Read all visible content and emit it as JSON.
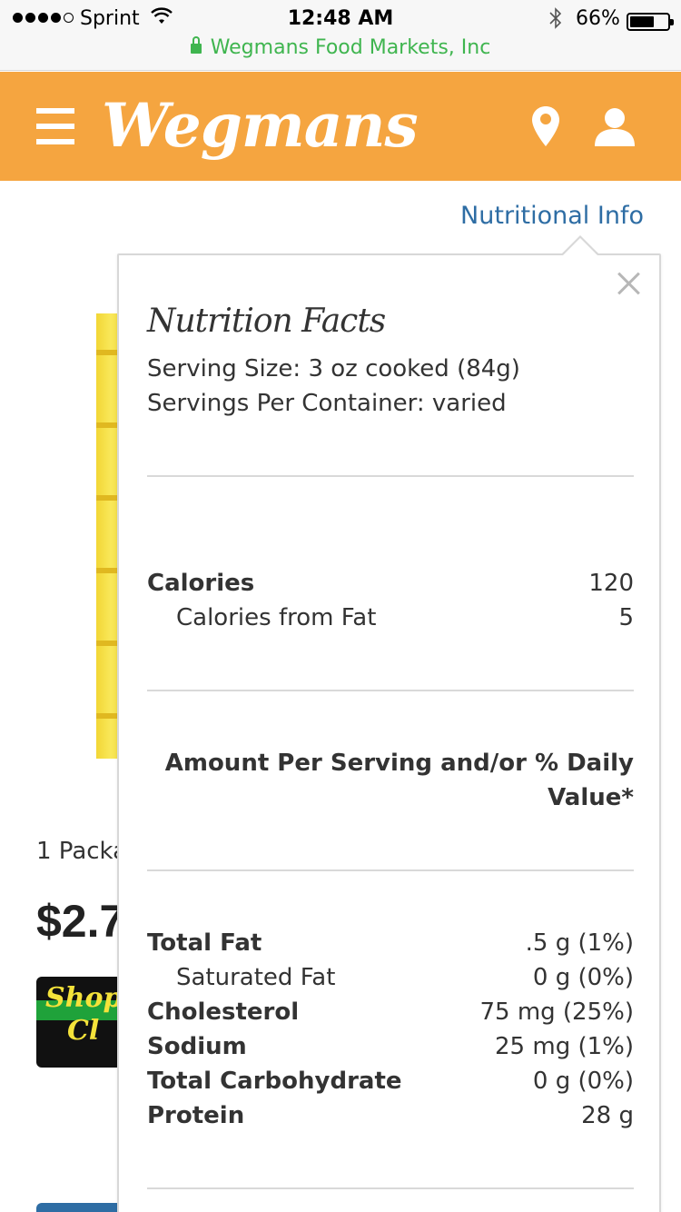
{
  "status_bar": {
    "carrier": "Sprint",
    "time": "12:48 AM",
    "battery": "66%",
    "battery_level": 0.66,
    "url": "Wegmans Food Markets, Inc"
  },
  "header": {
    "logo": "Wegmans",
    "brand_color": "#f5a540"
  },
  "page": {
    "nutritional_info_link": "Nutritional Info",
    "package_label": "1 Packa",
    "price": "$2.7",
    "badge_text_line1": "Shop",
    "badge_text_line2": "Cl"
  },
  "popup": {
    "title": "Nutrition Facts",
    "serving_size": "Serving Size: 3 oz cooked (84g)",
    "servings_per_container": "Servings Per Container: varied",
    "calories": {
      "label": "Calories",
      "value": "120"
    },
    "calories_from_fat": {
      "label": "Calories from Fat",
      "value": "5"
    },
    "amount_per_serving": "Amount Per Serving and/or % Daily Value*",
    "nutrients": [
      {
        "label": "Total Fat",
        "value": ".5 g (1%)"
      },
      {
        "label": "Saturated Fat",
        "value": "0 g (0%)"
      },
      {
        "label": "Cholesterol",
        "value": "75 mg (25%)"
      },
      {
        "label": "Sodium",
        "value": "25 mg (1%)"
      },
      {
        "label": "Total Carbohydrate",
        "value": "0 g (0%)"
      },
      {
        "label": "Protein",
        "value": "28 g"
      }
    ]
  }
}
